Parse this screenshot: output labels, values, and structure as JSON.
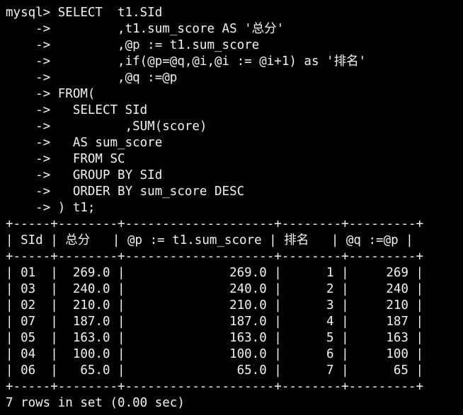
{
  "query": [
    "mysql> SELECT  t1.SId",
    "    ->         ,t1.sum_score AS '总分'",
    "    ->         ,@p := t1.sum_score",
    "    ->         ,if(@p=@q,@i,@i := @i+1) as '排名'",
    "    ->         ,@q :=@p",
    "    -> FROM(",
    "    ->   SELECT SId",
    "    ->          ,SUM(score)",
    "    ->   AS sum_score",
    "    ->   FROM SC",
    "    ->   GROUP BY SId",
    "    ->   ORDER BY sum_score DESC",
    "    -> ) t1;"
  ],
  "result_table": {
    "border": "+-----+--------+--------------------+--------+---------+",
    "header": "| SId | 总分   | @p := t1.sum_score | 排名   | @q :=@p |",
    "columns": [
      "SId",
      "总分",
      "@p := t1.sum_score",
      "排名",
      "@q :=@p"
    ],
    "rows": [
      {
        "text": "| 01  |  269.0 |              269.0 |      1 |     269 |",
        "cells": [
          "01",
          "269.0",
          "269.0",
          "1",
          "269"
        ]
      },
      {
        "text": "| 03  |  240.0 |              240.0 |      2 |     240 |",
        "cells": [
          "03",
          "240.0",
          "240.0",
          "2",
          "240"
        ]
      },
      {
        "text": "| 02  |  210.0 |              210.0 |      3 |     210 |",
        "cells": [
          "02",
          "210.0",
          "210.0",
          "3",
          "210"
        ]
      },
      {
        "text": "| 07  |  187.0 |              187.0 |      4 |     187 |",
        "cells": [
          "07",
          "187.0",
          "187.0",
          "4",
          "187"
        ]
      },
      {
        "text": "| 05  |  163.0 |              163.0 |      5 |     163 |",
        "cells": [
          "05",
          "163.0",
          "163.0",
          "5",
          "163"
        ]
      },
      {
        "text": "| 04  |  100.0 |              100.0 |      6 |     100 |",
        "cells": [
          "04",
          "100.0",
          "100.0",
          "6",
          "100"
        ]
      },
      {
        "text": "| 06  |   65.0 |               65.0 |      7 |      65 |",
        "cells": [
          "06",
          "65.0",
          "65.0",
          "7",
          "65"
        ]
      }
    ]
  },
  "status": "7 rows in set (0.00 sec)",
  "colors": {
    "background": "#000000",
    "text": "#f2f2f2"
  }
}
